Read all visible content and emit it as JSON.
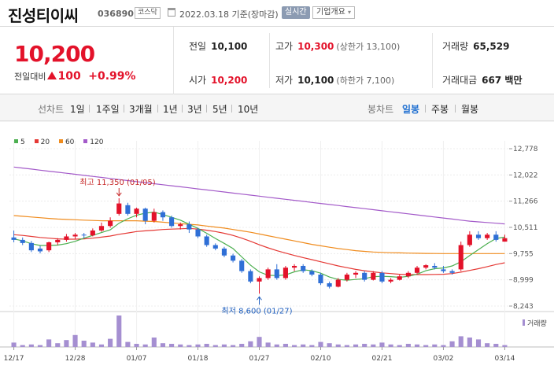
{
  "header": {
    "stock_name": "진성티이씨",
    "stock_code": "036890",
    "market": "코스닥",
    "date_text": "2022.03.18 기준(장마감)",
    "realtime_badge": "실시간",
    "company_info_button": "기업개요"
  },
  "quote": {
    "price": "10,200",
    "change_label": "전일대비",
    "change_value": "100",
    "change_rate": "+0.99%",
    "prev_close_label": "전일",
    "prev_close": "10,100",
    "open_label": "시가",
    "open": "10,200",
    "high_label": "고가",
    "high": "10,300",
    "upper_limit": "(상한가 13,100)",
    "low_label": "저가",
    "low": "10,100",
    "lower_limit": "(하한가 7,100)",
    "volume_label": "거래량",
    "volume": "65,529",
    "amount_label": "거래대금",
    "amount": "667 백만"
  },
  "period_bar": {
    "line_label": "선차트",
    "line_options": [
      "1일",
      "1주일",
      "3개월",
      "1년",
      "3년",
      "5년",
      "10년"
    ],
    "candle_label": "봉차트",
    "candle_options": [
      "일봉",
      "주봉",
      "월봉"
    ],
    "active_candle": "일봉"
  },
  "colors": {
    "up": "#e3122a",
    "down": "#2f6fd6",
    "ma5": "#4caf50",
    "ma20": "#e53935",
    "ma60": "#f08c1e",
    "ma120": "#a35ac9",
    "volume": "#a58fd1"
  },
  "chart_data": {
    "type": "candlestick",
    "legend": [
      "5",
      "20",
      "60",
      "120"
    ],
    "y_ticks": [
      12778,
      12022,
      11266,
      10511,
      9755,
      8999,
      8243
    ],
    "y_tick_labels": [
      "12,778",
      "12,022",
      "11,266",
      "10,511",
      "9,755",
      "8,999",
      "8,243"
    ],
    "ylim": [
      8243,
      12778
    ],
    "x_tick_labels": [
      "12/17",
      "12/28",
      "01/07",
      "01/18",
      "01/27",
      "02/10",
      "02/21",
      "03/02",
      "03/14"
    ],
    "x_tick_index": [
      0,
      7,
      14,
      21,
      28,
      35,
      42,
      49,
      56
    ],
    "volume_label": "거래량",
    "annotations": {
      "high": {
        "text": "최고 11,350 (01/05)",
        "index": 12,
        "value": 11350
      },
      "low": {
        "text": "최저 8,600 (01/27)",
        "index": 28,
        "value": 8600
      }
    },
    "candles": [
      [
        10220,
        10420,
        10080,
        10150
      ],
      [
        10150,
        10220,
        10000,
        10060
      ],
      [
        10060,
        10120,
        9800,
        9850
      ],
      [
        9900,
        9980,
        9760,
        9820
      ],
      [
        9850,
        10100,
        9800,
        10080
      ],
      [
        10080,
        10200,
        10000,
        10150
      ],
      [
        10150,
        10320,
        10100,
        10250
      ],
      [
        10250,
        10350,
        10180,
        10300
      ],
      [
        10300,
        10350,
        10200,
        10280
      ],
      [
        10280,
        10480,
        10250,
        10420
      ],
      [
        10420,
        10650,
        10380,
        10550
      ],
      [
        10550,
        10800,
        10500,
        10700
      ],
      [
        10900,
        11350,
        10850,
        11200
      ],
      [
        11150,
        11220,
        10850,
        10900
      ],
      [
        10900,
        11080,
        10800,
        11050
      ],
      [
        11050,
        11080,
        10600,
        10700
      ],
      [
        10700,
        11050,
        10650,
        10950
      ],
      [
        10950,
        11000,
        10700,
        10800
      ],
      [
        10800,
        10850,
        10500,
        10550
      ],
      [
        10550,
        10650,
        10450,
        10600
      ],
      [
        10600,
        10680,
        10350,
        10450
      ],
      [
        10450,
        10500,
        10200,
        10250
      ],
      [
        10250,
        10300,
        9950,
        10000
      ],
      [
        10000,
        10050,
        9850,
        9900
      ],
      [
        9900,
        9950,
        9650,
        9700
      ],
      [
        9700,
        9750,
        9500,
        9550
      ],
      [
        9550,
        9600,
        9200,
        9250
      ],
      [
        9250,
        9300,
        8900,
        8950
      ],
      [
        8950,
        9100,
        8600,
        9050
      ],
      [
        9050,
        9350,
        9000,
        9300
      ],
      [
        9300,
        9450,
        9000,
        9050
      ],
      [
        9050,
        9400,
        9000,
        9350
      ],
      [
        9350,
        9450,
        9250,
        9400
      ],
      [
        9400,
        9450,
        9200,
        9250
      ],
      [
        9250,
        9300,
        9100,
        9150
      ],
      [
        9150,
        9200,
        8850,
        8900
      ],
      [
        8900,
        8950,
        8750,
        8800
      ],
      [
        8800,
        9050,
        8780,
        9000
      ],
      [
        9000,
        9200,
        8950,
        9150
      ],
      [
        9150,
        9250,
        9050,
        9200
      ],
      [
        9200,
        9250,
        8950,
        9000
      ],
      [
        9000,
        9250,
        8980,
        9200
      ],
      [
        9200,
        9250,
        8900,
        8950
      ],
      [
        8950,
        9050,
        8900,
        9000
      ],
      [
        9000,
        9150,
        8980,
        9100
      ],
      [
        9100,
        9250,
        9050,
        9200
      ],
      [
        9200,
        9400,
        9150,
        9350
      ],
      [
        9350,
        9450,
        9300,
        9420
      ],
      [
        9400,
        9480,
        9300,
        9350
      ],
      [
        9300,
        9400,
        9200,
        9250
      ],
      [
        9250,
        9300,
        9150,
        9200
      ],
      [
        9300,
        10100,
        9250,
        10000
      ],
      [
        10000,
        10400,
        9950,
        10300
      ],
      [
        10300,
        10400,
        10150,
        10200
      ],
      [
        10200,
        10350,
        10150,
        10300
      ],
      [
        10300,
        10400,
        10100,
        10150
      ],
      [
        10100,
        10300,
        10100,
        10200
      ]
    ],
    "volumes": [
      14,
      6,
      8,
      6,
      24,
      12,
      22,
      38,
      20,
      14,
      8,
      26,
      100,
      16,
      10,
      8,
      30,
      12,
      10,
      8,
      6,
      8,
      10,
      6,
      8,
      6,
      10,
      18,
      32,
      14,
      8,
      10,
      6,
      8,
      6,
      16,
      12,
      8,
      6,
      8,
      10,
      8,
      14,
      8,
      6,
      10,
      8,
      6,
      8,
      6,
      18,
      34,
      30,
      24,
      12,
      10,
      6
    ],
    "ma5": [
      10180,
      10120,
      10040,
      9990,
      9990,
      10000,
      10040,
      10110,
      10200,
      10280,
      10360,
      10440,
      10630,
      10760,
      10860,
      10920,
      10950,
      10880,
      10800,
      10720,
      10600,
      10480,
      10340,
      10190,
      10050,
      9900,
      9660,
      9420,
      9230,
      9130,
      9120,
      9140,
      9230,
      9290,
      9260,
      9190,
      9080,
      9010,
      8990,
      9010,
      9030,
      9090,
      9100,
      9090,
      9070,
      9100,
      9160,
      9260,
      9320,
      9340,
      9400,
      9520,
      9700,
      9870,
      10040,
      10190,
      10230
    ],
    "ma20": [
      10300,
      10280,
      10250,
      10220,
      10200,
      10180,
      10170,
      10170,
      10180,
      10200,
      10230,
      10260,
      10310,
      10350,
      10390,
      10410,
      10430,
      10450,
      10460,
      10470,
      10480,
      10460,
      10430,
      10390,
      10340,
      10280,
      10200,
      10110,
      10010,
      9920,
      9840,
      9770,
      9700,
      9640,
      9580,
      9520,
      9460,
      9400,
      9350,
      9300,
      9260,
      9230,
      9200,
      9180,
      9160,
      9150,
      9150,
      9150,
      9155,
      9160,
      9180,
      9220,
      9270,
      9320,
      9380,
      9440,
      9490
    ],
    "ma60": [
      10850,
      10830,
      10810,
      10790,
      10770,
      10750,
      10740,
      10730,
      10720,
      10710,
      10700,
      10700,
      10700,
      10700,
      10700,
      10690,
      10680,
      10660,
      10640,
      10620,
      10600,
      10580,
      10550,
      10520,
      10490,
      10450,
      10410,
      10370,
      10320,
      10270,
      10220,
      10170,
      10120,
      10070,
      10020,
      9980,
      9940,
      9900,
      9870,
      9840,
      9820,
      9800,
      9790,
      9780,
      9775,
      9770,
      9765,
      9760,
      9758,
      9756,
      9755,
      9755,
      9755,
      9755,
      9755,
      9755,
      9755
    ],
    "ma120": [
      12250,
      12220,
      12190,
      12160,
      12130,
      12100,
      12070,
      12040,
      12010,
      11980,
      11950,
      11920,
      11890,
      11860,
      11830,
      11800,
      11770,
      11740,
      11710,
      11680,
      11650,
      11620,
      11590,
      11560,
      11530,
      11500,
      11470,
      11440,
      11410,
      11380,
      11350,
      11320,
      11290,
      11260,
      11230,
      11200,
      11170,
      11140,
      11110,
      11080,
      11050,
      11020,
      10990,
      10960,
      10930,
      10900,
      10870,
      10840,
      10810,
      10780,
      10750,
      10720,
      10690,
      10670,
      10650,
      10630,
      10610
    ]
  }
}
